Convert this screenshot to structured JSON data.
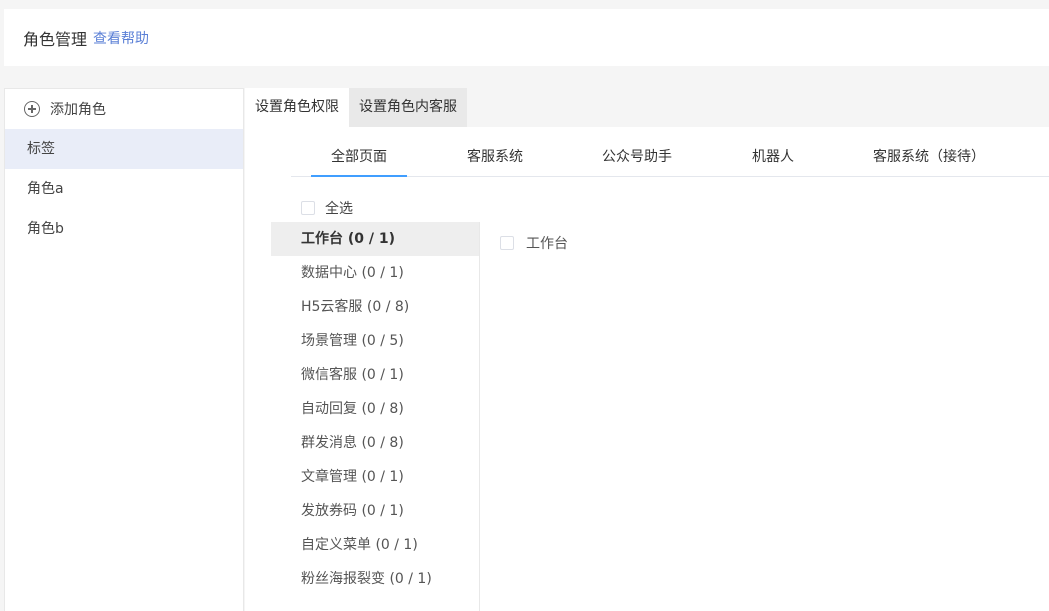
{
  "header": {
    "title": "角色管理",
    "help_link": "查看帮助"
  },
  "left": {
    "add_role": "添加角色",
    "roles": [
      {
        "label": "标签",
        "active": true
      },
      {
        "label": "角色a",
        "active": false
      },
      {
        "label": "角色b",
        "active": false
      }
    ]
  },
  "tabs": {
    "permissions": "设置角色权限",
    "agents": "设置角色内客服"
  },
  "sub_tabs": [
    "全部页面",
    "客服系统",
    "公众号助手",
    "机器人",
    "客服系统（接待）"
  ],
  "select_all": "全选",
  "categories": [
    "工作台 (0 / 1)",
    "数据中心 (0 / 1)",
    "H5云客服 (0 / 8)",
    "场景管理 (0 / 5)",
    "微信客服 (0 / 1)",
    "自动回复 (0 / 8)",
    "群发消息 (0 / 8)",
    "文章管理 (0 / 1)",
    "发放券码 (0 / 1)",
    "自定义菜单 (0 / 1)",
    "粉丝海报裂变 (0 / 1)"
  ],
  "permissions": [
    "工作台"
  ],
  "colors": {
    "accent": "#409eff",
    "link": "#5a7fd6",
    "active_role_bg": "#e9edf8"
  }
}
